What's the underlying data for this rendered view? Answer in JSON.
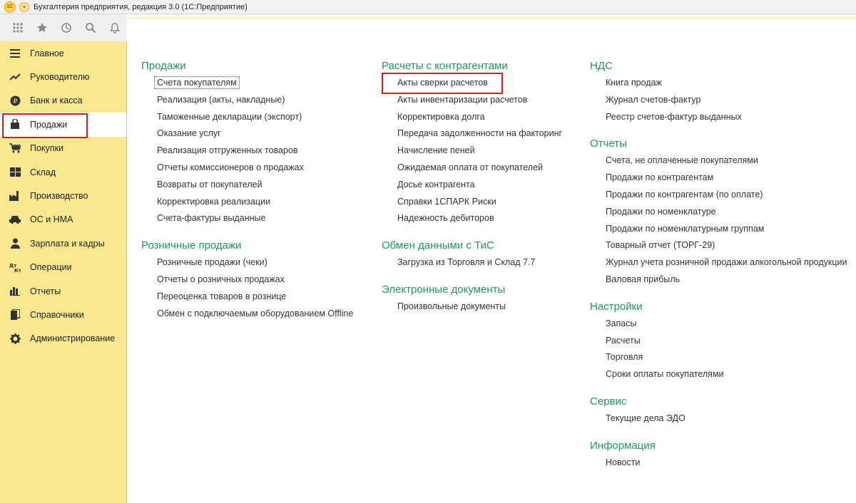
{
  "window": {
    "logo": "1С",
    "title": "Бухгалтерия предприятия, редакция 3.0   (1С:Предприятие)"
  },
  "toolbar": {
    "icons": [
      "apps-grid-icon",
      "star-icon",
      "history-icon",
      "search-icon",
      "bell-icon"
    ]
  },
  "sidebar": {
    "items": [
      {
        "label": "Главное",
        "icon": "menu-lines-icon"
      },
      {
        "label": "Руководителю",
        "icon": "trend-icon"
      },
      {
        "label": "Банк и касса",
        "icon": "coin-icon"
      },
      {
        "label": "Продажи",
        "icon": "bag-icon",
        "active": true
      },
      {
        "label": "Покупки",
        "icon": "cart-icon"
      },
      {
        "label": "Склад",
        "icon": "warehouse-icon"
      },
      {
        "label": "Производство",
        "icon": "factory-icon"
      },
      {
        "label": "ОС и НМА",
        "icon": "car-icon"
      },
      {
        "label": "Зарплата и кадры",
        "icon": "person-icon"
      },
      {
        "label": "Операции",
        "icon": "dt-kt-icon"
      },
      {
        "label": "Отчеты",
        "icon": "bar-chart-icon"
      },
      {
        "label": "Справочники",
        "icon": "book-icon"
      },
      {
        "label": "Администрирование",
        "icon": "gear-icon"
      }
    ]
  },
  "content": {
    "col1": {
      "sections": [
        {
          "title": "Продажи",
          "links": [
            "Счета покупателям",
            "Реализация (акты, накладные)",
            "Таможенные декларации (экспорт)",
            "Оказание услуг",
            "Реализация отгруженных товаров",
            "Отчеты комиссионеров о продажах",
            "Возвраты от покупателей",
            "Корректировка реализации",
            "Счета-фактуры выданные"
          ]
        },
        {
          "title": "Розничные продажи",
          "links": [
            "Розничные продажи (чеки)",
            "Отчеты о розничных продажах",
            "Переоценка товаров в рознице",
            "Обмен с подключаемым оборудованием Offline"
          ]
        }
      ]
    },
    "col2": {
      "sections": [
        {
          "title": "Расчеты с контрагентами",
          "links": [
            "Акты сверки расчетов",
            "Акты инвентаризации расчетов",
            "Корректировка долга",
            "Передача задолженности на факторинг",
            "Начисление пеней",
            "Ожидаемая оплата от покупателей",
            "Досье контрагента",
            "Справки 1СПАРК Риски",
            "Надежность дебиторов"
          ]
        },
        {
          "title": "Обмен данными с ТиС",
          "links": [
            "Загрузка из Торговля и Склад 7.7"
          ]
        },
        {
          "title": "Электронные документы",
          "links": [
            "Произвольные документы"
          ]
        }
      ]
    },
    "col3": {
      "sections": [
        {
          "title": "НДС",
          "links": [
            "Книга продаж",
            "Журнал счетов-фактур",
            "Реестр счетов-фактур выданных"
          ]
        },
        {
          "title": "Отчеты",
          "links": [
            "Счета, не оплаченные покупателями",
            "Продажи по контрагентам",
            "Продажи по контрагентам (по оплате)",
            "Продажи по номенклатуре",
            "Продажи по номенклатурным группам",
            "Товарный отчет (ТОРГ-29)",
            "Журнал учета розничной продажи алкогольной продукции",
            "Валовая прибыль"
          ]
        },
        {
          "title": "Настройки",
          "links": [
            "Запасы",
            "Расчеты",
            "Торговля",
            "Сроки оплаты покупателями"
          ]
        },
        {
          "title": "Сервис",
          "links": [
            "Текущие дела ЭДО"
          ]
        },
        {
          "title": "Информация",
          "links": [
            "Новости"
          ]
        }
      ]
    }
  },
  "colors": {
    "sidebar_bg": "#fbe790",
    "section_title": "#229460",
    "highlight": "#e8141c"
  }
}
